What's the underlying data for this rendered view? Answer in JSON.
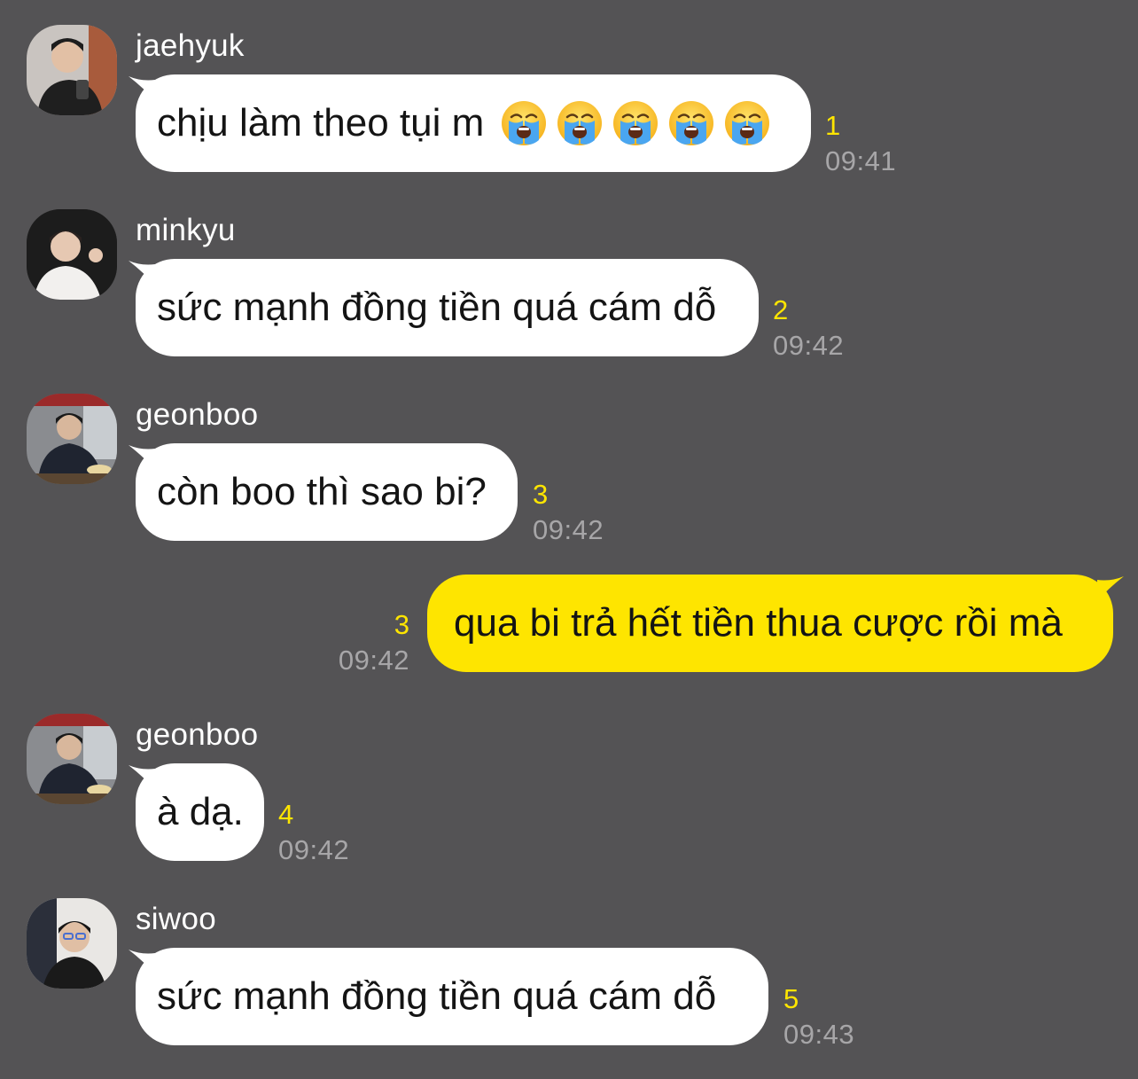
{
  "colors": {
    "background": "#545355",
    "incoming_bubble": "#ffffff",
    "outgoing_bubble": "#fee500",
    "unread_count": "#fee500",
    "timestamp": "#a7a6a8"
  },
  "messages": [
    {
      "sender": "jaehyuk",
      "text": "chịu làm theo tụi m",
      "emoji": [
        "loudly-crying-face",
        "loudly-crying-face",
        "loudly-crying-face",
        "loudly-crying-face",
        "loudly-crying-face"
      ],
      "unread": "1",
      "time": "09:41"
    },
    {
      "sender": "minkyu",
      "text": "sức mạnh đồng tiền quá cám dỗ",
      "unread": "2",
      "time": "09:42"
    },
    {
      "sender": "geonboo",
      "text": "còn boo thì sao bi?",
      "unread": "3",
      "time": "09:42"
    },
    {
      "sender": "me",
      "text": "qua bi trả hết tiền thua cược rồi mà",
      "unread": "3",
      "time": "09:42"
    },
    {
      "sender": "geonboo",
      "text": "à dạ.",
      "unread": "4",
      "time": "09:42"
    },
    {
      "sender": "siwoo",
      "text": "sức mạnh đồng tiền quá cám dỗ",
      "unread": "5",
      "time": "09:43"
    }
  ]
}
